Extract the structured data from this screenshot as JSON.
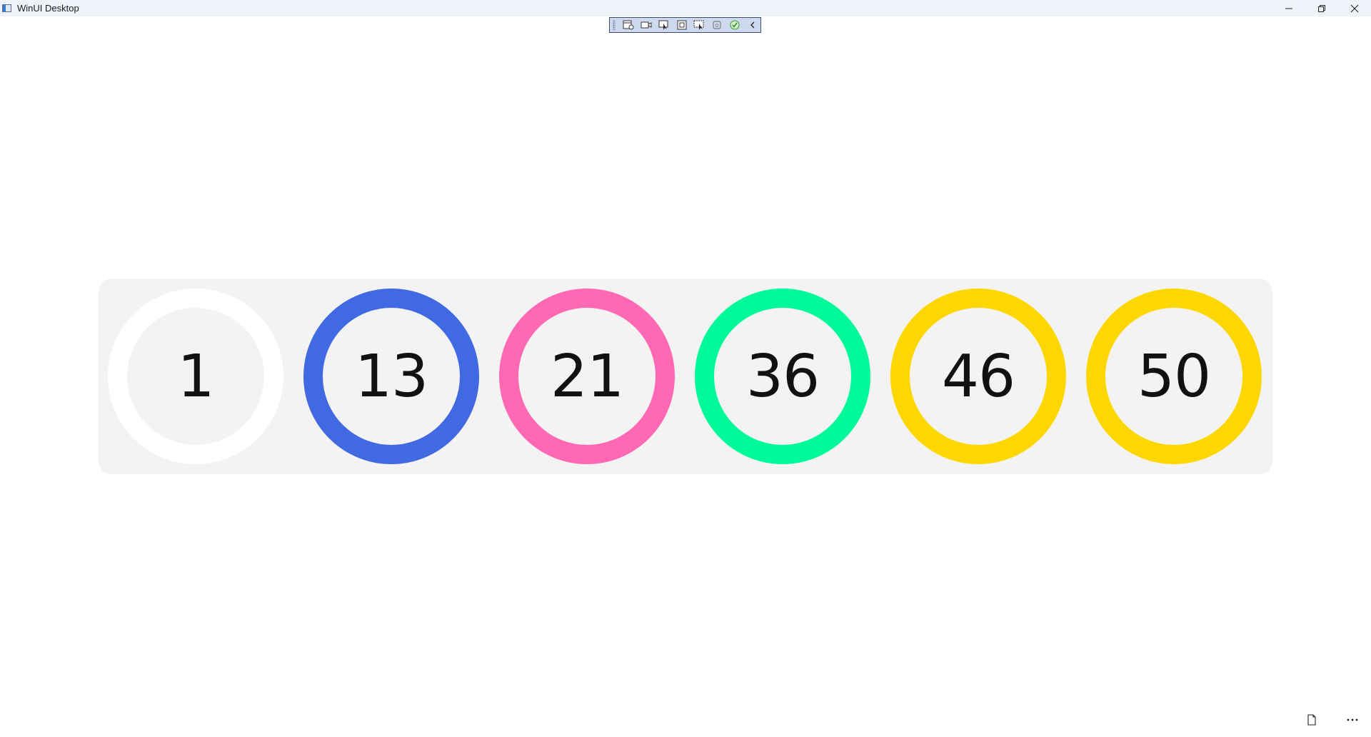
{
  "window": {
    "title": "WinUI Desktop"
  },
  "debug_toolbar": {
    "buttons": [
      "live-visual-tree-icon",
      "record-icon",
      "select-element-icon",
      "display-layout-adorners-icon",
      "track-focus-icon",
      "binding-failures-icon",
      "accessibility-check-icon",
      "collapse-chevron-icon"
    ]
  },
  "rings": [
    {
      "value": "1",
      "color": "#ffffff"
    },
    {
      "value": "13",
      "color": "#4169e1"
    },
    {
      "value": "21",
      "color": "#ff69b4"
    },
    {
      "value": "36",
      "color": "#00fa9a"
    },
    {
      "value": "46",
      "color": "#ffd700"
    },
    {
      "value": "50",
      "color": "#ffd700"
    }
  ],
  "colors": {
    "panel_background": "#f3f3f3",
    "titlebar_background": "#eef3f9"
  },
  "footer": {
    "buttons": [
      "document-icon",
      "more-options-icon"
    ]
  }
}
